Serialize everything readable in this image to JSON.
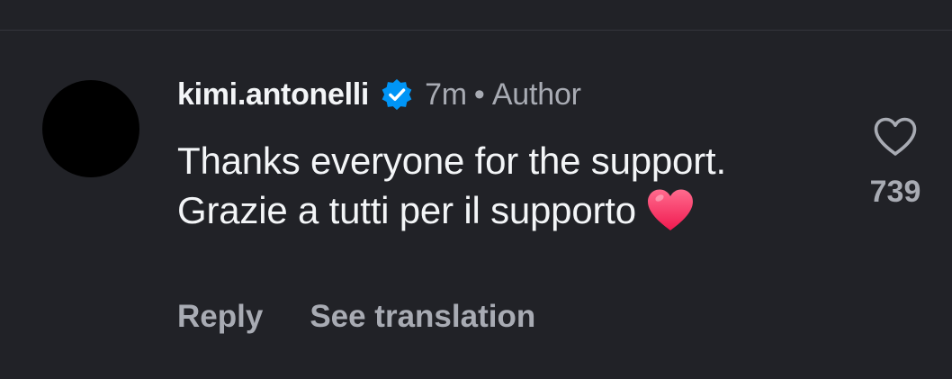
{
  "comment": {
    "username": "kimi.antonelli",
    "verified_icon": "verified-badge-icon",
    "time": "7m",
    "separator": "•",
    "role": "Author",
    "text": "Thanks everyone for the support. Grazie a tutti per il supporto",
    "emoji": "red-heart-emoji",
    "actions": {
      "reply": "Reply",
      "translate": "See translation"
    },
    "likes": {
      "icon": "heart-outline-icon",
      "count": "739"
    }
  },
  "colors": {
    "background": "#212227",
    "text_primary": "#f3f5f7",
    "text_secondary": "#a8abb3",
    "verified_blue": "#0095f6",
    "heart_pink": "#ff3d6e"
  }
}
